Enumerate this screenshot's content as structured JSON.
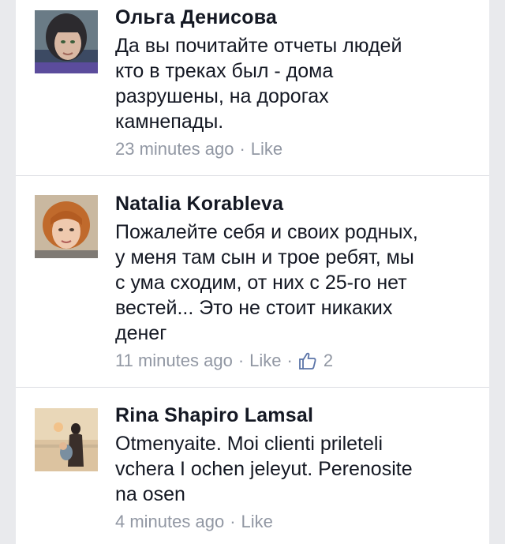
{
  "comments": [
    {
      "author": "Ольга Денисова",
      "lines": [
        "Да вы почитайте отчеты людей",
        "кто в треках был - дома",
        "разрушены, на дорогах",
        "камнепады."
      ],
      "time": "23 minutes ago",
      "separator": "·",
      "like_label": "Like"
    },
    {
      "author": "Natalia  Korableva",
      "lines": [
        "Пожалейте себя и своих родных,",
        "у меня там сын и трое ребят, мы",
        "с ума сходим, от них с 25-го нет",
        "вестей... Это не стоит никаких",
        "денег"
      ],
      "time": "11 minutes ago",
      "separator": "·",
      "like_label": "Like",
      "like_count": "2",
      "like_icon": "thumbs-up-icon"
    },
    {
      "author": "Rina Shapiro Lamsal",
      "lines": [
        "Otmenyaite. Moi clienti prileteli",
        "vchera I ochen jeleyut. Perenosite",
        "na osen"
      ],
      "time": "4 minutes ago",
      "separator": "·",
      "like_label": "Like"
    }
  ],
  "colors": {
    "background": "#e9eaed",
    "text": "#141823",
    "meta": "#9197a3",
    "like_icon": "#5b74a8"
  }
}
